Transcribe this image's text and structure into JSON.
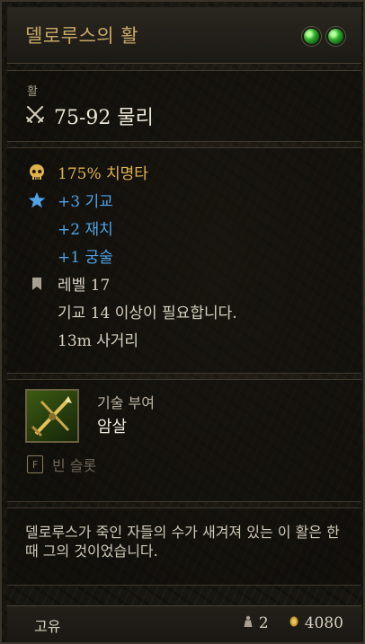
{
  "item": {
    "title": "델로루스의 활",
    "weapon_type": "활",
    "damage": "75-92 물리"
  },
  "stats": [
    {
      "icon": "skull-icon",
      "text": "175% 치명타",
      "color": "#e0b24c"
    },
    {
      "icon": "star-icon",
      "text": "+3 기교",
      "color": "#4fa3e6"
    },
    {
      "icon": "",
      "text": "+2 재치",
      "color": "#4fa3e6"
    },
    {
      "icon": "",
      "text": "+1 궁술",
      "color": "#4fa3e6"
    },
    {
      "icon": "bookmark-icon",
      "text": "레벨 17",
      "color": "#d6d0c0"
    },
    {
      "icon": "",
      "text": "기교 14 이상이 필요합니다.",
      "color": "#d6d0c0"
    },
    {
      "icon": "",
      "text": "13m 사거리",
      "color": "#d6d0c0"
    }
  ],
  "skill": {
    "caption": "기술 부여",
    "name": "암살",
    "icon": "crossbow-arrow-icon",
    "empty_slot_icon": "F",
    "empty_slot": "빈 슬롯"
  },
  "description": "델로루스가 죽인 자들의 수가 새겨져 있는 이 활은 한때 그의 것이었습니다.",
  "footer": {
    "rarity": "고유",
    "weight": "2",
    "value": "4080"
  },
  "colors": {
    "title": "#c9a866",
    "gem": "#2fae2f",
    "stat_gold": "#e0b24c",
    "stat_blue": "#4fa3e6"
  }
}
